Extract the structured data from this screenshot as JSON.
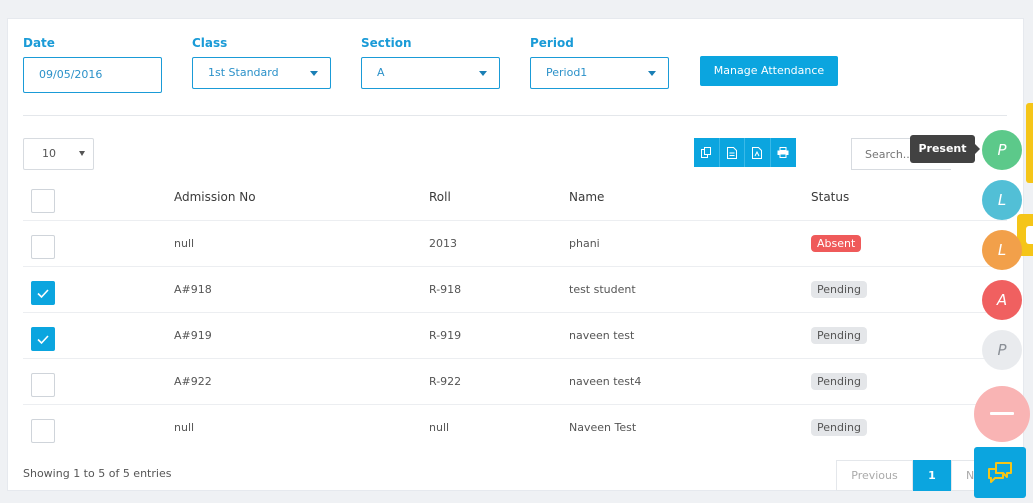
{
  "filters": {
    "date": {
      "label": "Date",
      "value": "09/05/2016"
    },
    "class": {
      "label": "Class",
      "value": "1st Standard"
    },
    "section": {
      "label": "Section",
      "value": "A"
    },
    "period": {
      "label": "Period",
      "value": "Period1"
    },
    "manage_button": "Manage Attendance"
  },
  "table_controls": {
    "page_length": "10",
    "search_placeholder": "Search..",
    "export_icons": [
      "copy-icon",
      "csv-icon",
      "pdf-icon",
      "print-icon"
    ]
  },
  "table": {
    "columns": [
      "Admission No",
      "Roll",
      "Name",
      "Status"
    ],
    "rows": [
      {
        "admission": "null",
        "roll": "2013",
        "name": "phani",
        "status": "Absent",
        "checked": false
      },
      {
        "admission": "A#918",
        "roll": "R-918",
        "name": "test student",
        "status": "Pending",
        "checked": true
      },
      {
        "admission": "A#919",
        "roll": "R-919",
        "name": "naveen test",
        "status": "Pending",
        "checked": true
      },
      {
        "admission": "A#922",
        "roll": "R-922",
        "name": "naveen test4",
        "status": "Pending",
        "checked": false
      },
      {
        "admission": "null",
        "roll": "null",
        "name": "Naveen Test",
        "status": "Pending",
        "checked": false
      }
    ]
  },
  "footer": {
    "info": "Showing 1 to 5 of 5 entries",
    "previous": "Previous",
    "page": "1",
    "next": "N"
  },
  "fab_menu": {
    "tooltip": "Present",
    "items": [
      {
        "letter": "P",
        "meaning": "Present",
        "color": "#5cc98a"
      },
      {
        "letter": "L",
        "color": "#52bfd6"
      },
      {
        "letter": "L",
        "color": "#f2a04a"
      },
      {
        "letter": "A",
        "color": "#f06060"
      },
      {
        "letter": "P",
        "color": "#e9ebee"
      }
    ],
    "close_color": "#f9b4b4",
    "chat_color": "#0ba5df"
  },
  "colors": {
    "accent": "#0ba5df",
    "label_blue": "#1a9bd7",
    "absent": "#ef5a5a",
    "pending_bg": "#e4e6e9"
  }
}
